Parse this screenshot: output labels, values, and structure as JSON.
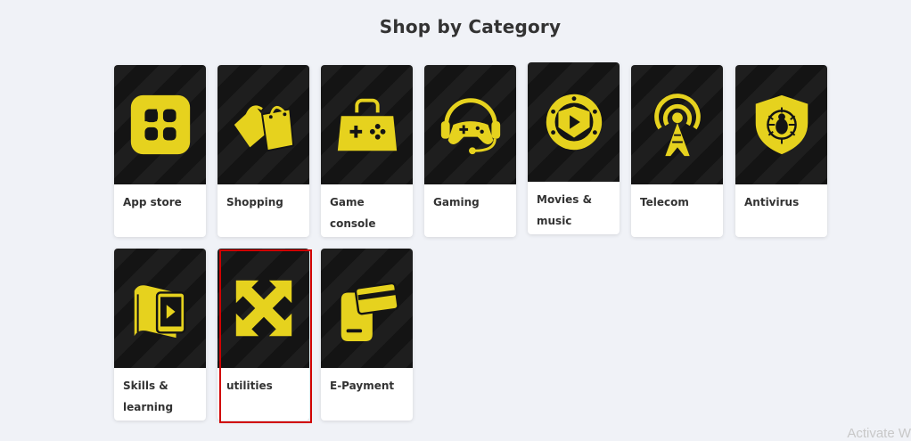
{
  "section": {
    "title": "Shop by Category"
  },
  "accent_color": "#e6d21e",
  "categories": [
    {
      "label": "App store",
      "icon": "app-grid-icon"
    },
    {
      "label": "Shopping",
      "icon": "shopping-bags-icon"
    },
    {
      "label": "Game console",
      "icon": "game-controller-bag-icon"
    },
    {
      "label": "Gaming",
      "icon": "gaming-headset-icon"
    },
    {
      "label": "Movies & music",
      "icon": "film-reel-play-icon"
    },
    {
      "label": "Telecom",
      "icon": "antenna-tower-icon"
    },
    {
      "label": "Antivirus",
      "icon": "bug-shield-icon"
    },
    {
      "label": "Skills & learning",
      "icon": "book-tablet-icon"
    },
    {
      "label": "utilities",
      "icon": "expand-arrows-icon"
    },
    {
      "label": "E-Payment",
      "icon": "phone-card-icon"
    }
  ],
  "watermark": {
    "text": "Activate W"
  }
}
